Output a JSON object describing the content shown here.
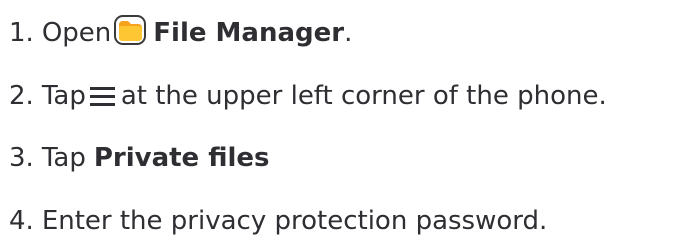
{
  "steps": [
    {
      "number": "1.",
      "before": "Open",
      "icon": "file-manager-app-icon",
      "bold": "File Manager",
      "after": "."
    },
    {
      "number": "2.",
      "before": "Tap",
      "icon": "hamburger-menu-icon",
      "after": "at the upper left corner of the phone."
    },
    {
      "number": "3.",
      "before": "Tap",
      "bold": "Private files"
    },
    {
      "number": "4.",
      "text": "Enter the privacy protection password."
    }
  ],
  "colors": {
    "text": "#2e2e33",
    "folder_orange": "#f7a21c",
    "folder_light": "#ffd24d",
    "folder_outline": "#3a3a3a"
  }
}
